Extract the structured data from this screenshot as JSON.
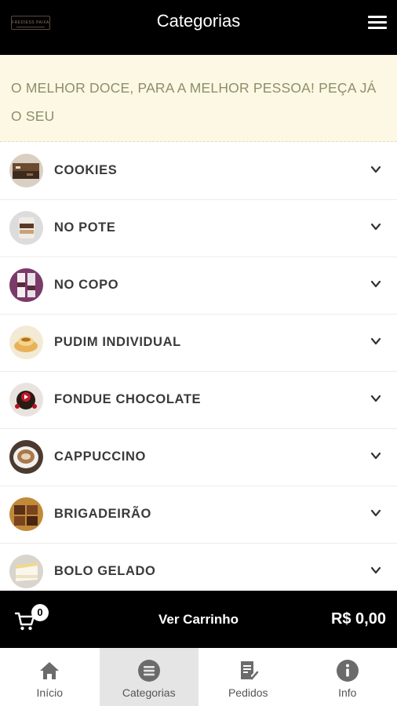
{
  "header": {
    "title": "Categorias",
    "logo_text": "FREDIESS PAIXA"
  },
  "banner": {
    "text": "O MELHOR DOCE, PARA A MELHOR PESSOA! PEÇA JÁ O SEU"
  },
  "categories": [
    {
      "label": "COOKIES",
      "icon": "cookies-thumbnail"
    },
    {
      "label": "NO POTE",
      "icon": "pot-dessert-thumbnail"
    },
    {
      "label": "NO COPO",
      "icon": "cup-dessert-thumbnail"
    },
    {
      "label": "PUDIM INDIVIDUAL",
      "icon": "pudding-thumbnail"
    },
    {
      "label": "FONDUE CHOCOLATE",
      "icon": "fondue-thumbnail"
    },
    {
      "label": "CAPPUCCINO",
      "icon": "cappuccino-thumbnail"
    },
    {
      "label": "BRIGADEIRÃO",
      "icon": "brigadeirao-thumbnail"
    },
    {
      "label": "BOLO GELADO",
      "icon": "cold-cake-thumbnail"
    }
  ],
  "cart": {
    "count": "0",
    "label": "Ver Carrinho",
    "total": "R$ 0,00"
  },
  "nav": {
    "items": [
      {
        "label": "Início",
        "icon": "home-icon"
      },
      {
        "label": "Categorias",
        "icon": "categories-icon",
        "active": true
      },
      {
        "label": "Pedidos",
        "icon": "orders-icon"
      },
      {
        "label": "Info",
        "icon": "info-icon"
      }
    ]
  },
  "colors": {
    "header_bg": "#000000",
    "banner_bg": "#fdf8e4",
    "banner_text": "#8b8f6a",
    "nav_active_bg": "#e5e5e5"
  }
}
